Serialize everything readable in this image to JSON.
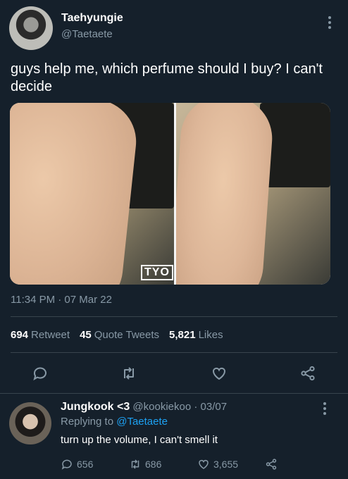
{
  "tweet": {
    "author_name": "Taehyungie",
    "author_handle": "@Taetaete",
    "text": "guys help me, which perfume should I buy? I can't decide",
    "media_watermark": "TYO",
    "timestamp": "11:34 PM · 07 Mar 22"
  },
  "stats": {
    "retweets": {
      "value": "694",
      "label": "Retweet"
    },
    "quote_tweets": {
      "value": "45",
      "label": "Quote Tweets"
    },
    "likes": {
      "value": "5,821",
      "label": "Likes"
    }
  },
  "actions": [
    "reply-icon",
    "retweet-icon",
    "like-icon",
    "share-icon"
  ],
  "reply": {
    "author_name": "Jungkook <3",
    "author_handle": "@kookiekoo",
    "date": "· 03/07",
    "replying_label": "Replying to",
    "replying_to": "@Taetaete",
    "text": "turn up the volume, I can't smell it",
    "counts": {
      "replies": "656",
      "retweets": "686",
      "likes": "3,655"
    }
  },
  "colors": {
    "background": "#15202b",
    "secondary_text": "#8899a6",
    "link": "#1da1f2",
    "divider": "#38444d"
  }
}
